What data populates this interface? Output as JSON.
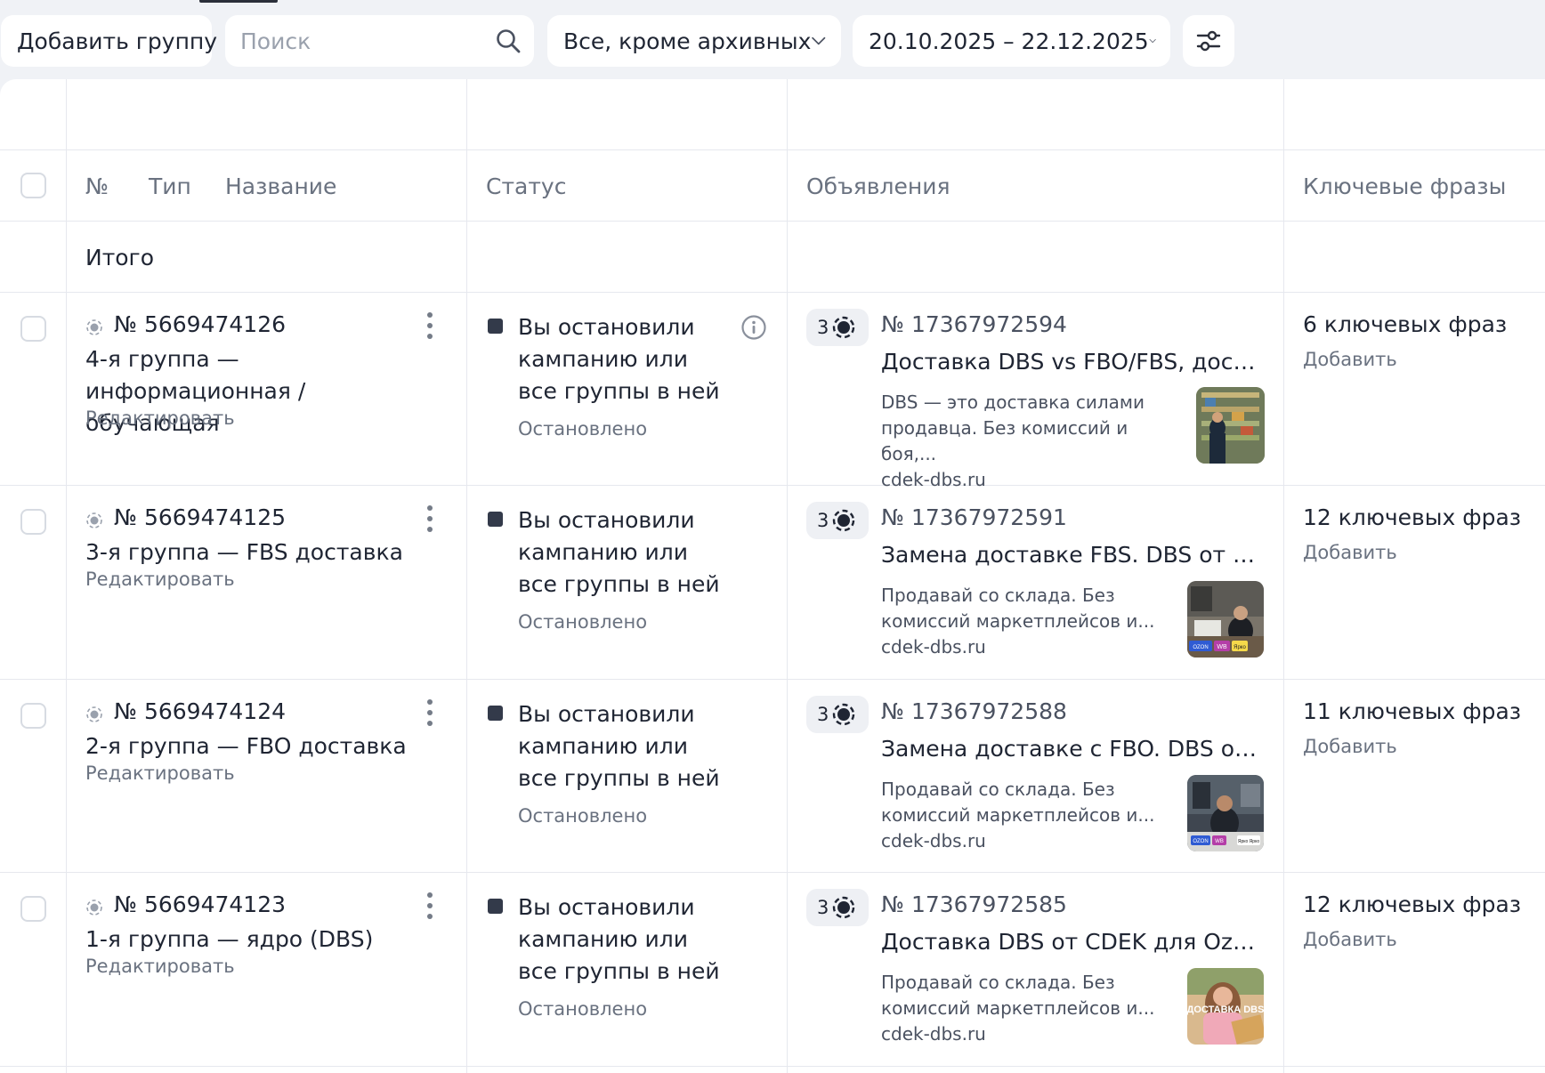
{
  "toolbar": {
    "add_group_label": "Добавить группу",
    "search_placeholder": "Поиск",
    "filter_label": "Все, кроме архивных",
    "date_range": "20.10.2025 – 22.12.2025"
  },
  "table": {
    "headers": {
      "number": "№",
      "type": "Тип",
      "name": "Название",
      "status": "Статус",
      "ads": "Объявления",
      "keywords": "Ключевые фразы"
    },
    "total_label": "Итого",
    "rows": [
      {
        "group_id": "№ 5669474126",
        "group_name": "4-я группа — информационная / обучающая",
        "edit_label": "Редактировать",
        "status_text": "Вы остановили кампанию или все группы в ней",
        "status_sub": "Остановлено",
        "ads_count": "3",
        "ad_id": "№ 17367972594",
        "ad_title": "Доставка DBS vs FBO/FBS, достав...",
        "ad_desc": "DBS — это доставка силами продавца. Без комиссий и боя,...",
        "ad_domain": "cdek-dbs.ru",
        "keywords_count": "6 ключевых фраз",
        "keywords_add": "Добавить"
      },
      {
        "group_id": "№ 5669474125",
        "group_name": "3-я группа — FBS доставка",
        "edit_label": "Редактировать",
        "status_text": "Вы остановили кампанию или все группы в ней",
        "status_sub": "Остановлено",
        "ads_count": "3",
        "ad_id": "№ 17367972591",
        "ad_title": "Замена доставке FBS. DBS от CDE...",
        "ad_desc": "Продавай со склада. Без комиссий маркетплейсов и...",
        "ad_domain": "cdek-dbs.ru",
        "keywords_count": "12 ключевых фраз",
        "keywords_add": "Добавить"
      },
      {
        "group_id": "№ 5669474124",
        "group_name": "2-я группа — FBO доставка",
        "edit_label": "Редактировать",
        "status_text": "Вы остановили кампанию или все группы в ней",
        "status_sub": "Остановлено",
        "ads_count": "3",
        "ad_id": "№ 17367972588",
        "ad_title": "Замена доставке с FBO. DBS от CD...",
        "ad_desc": "Продавай со склада. Без комиссий маркетплейсов и...",
        "ad_domain": "cdek-dbs.ru",
        "keywords_count": "11 ключевых фраз",
        "keywords_add": "Добавить"
      },
      {
        "group_id": "№ 5669474123",
        "group_name": "1-я группа — ядро (DBS)",
        "edit_label": "Редактировать",
        "status_text": "Вы остановили кампанию или все группы в ней",
        "status_sub": "Остановлено",
        "ads_count": "3",
        "ad_id": "№ 17367972585",
        "ad_title": "Доставка DBS от CDEK для Ozon, ...",
        "ad_desc": "Продавай со склада. Без комиссий маркетплейсов и...",
        "ad_domain": "cdek-dbs.ru",
        "keywords_count": "12 ключевых фраз",
        "keywords_add": "Добавить"
      }
    ]
  },
  "thumbnails": {
    "thumb2_badges": [
      "OZON",
      "WB",
      "Ярко"
    ],
    "thumb3_badges": [
      "OZON",
      "WB",
      "Ярко Ярко"
    ],
    "thumb4_caption": "ДОСТАВКА DBS"
  }
}
